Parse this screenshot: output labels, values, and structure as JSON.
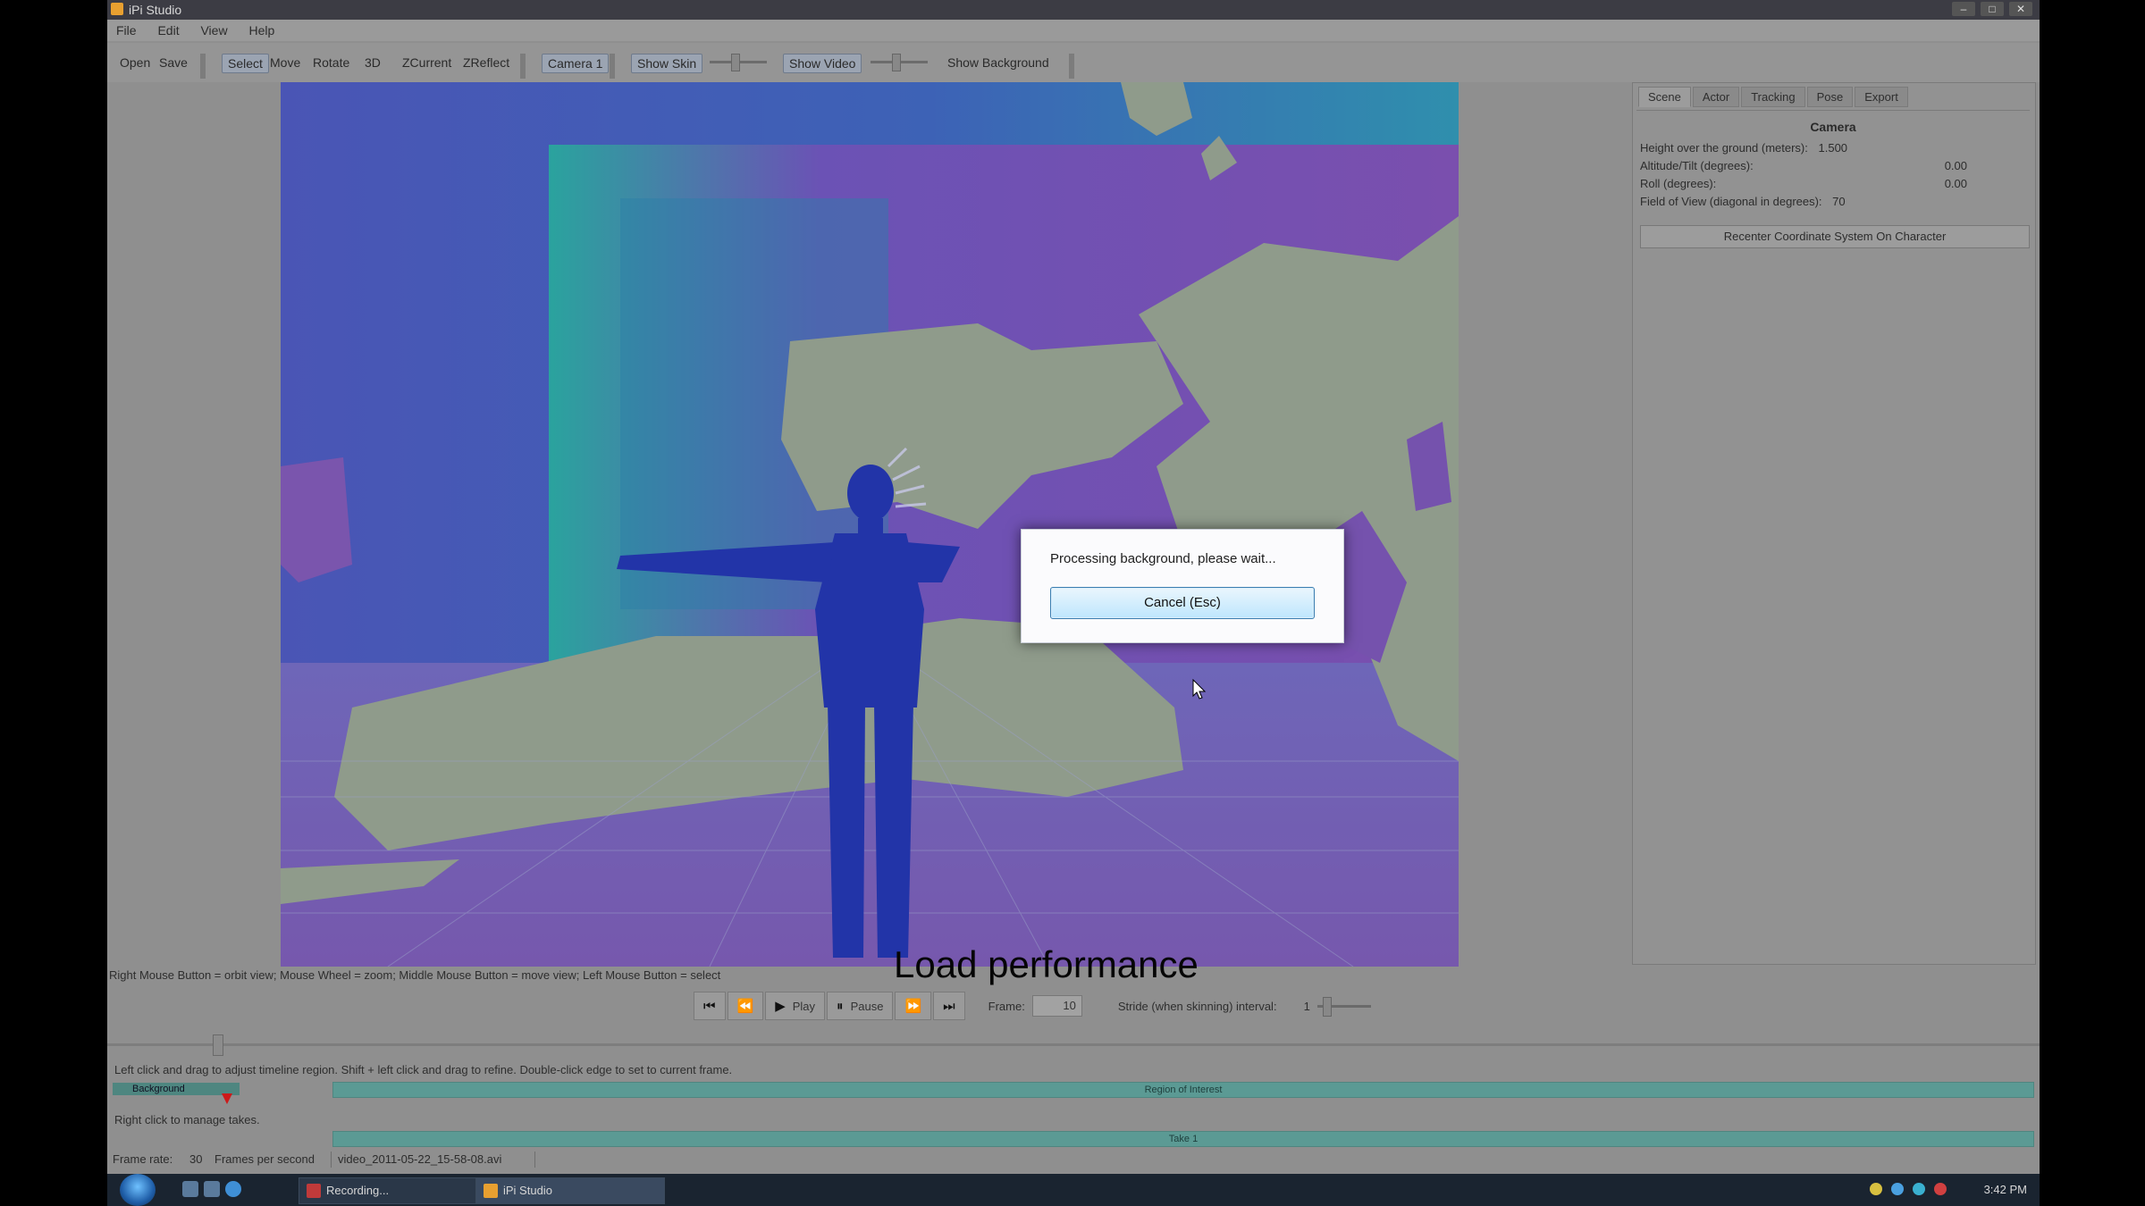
{
  "window": {
    "title": "iPi Studio",
    "controls": [
      "–",
      "□",
      "✕"
    ]
  },
  "menu": [
    "File",
    "Edit",
    "View",
    "Help"
  ],
  "toolbar": {
    "open": "Open",
    "save": "Save",
    "select": "Select",
    "move": "Move",
    "rotate": "Rotate",
    "view3d": "3D",
    "zcurrent": "ZCurrent",
    "zreflect": "ZReflect",
    "camera": "Camera 1",
    "show_skin": "Show Skin",
    "show_video": "Show Video",
    "show_background": "Show Background"
  },
  "right_panel": {
    "tabs": [
      "Scene",
      "Actor",
      "Tracking",
      "Pose",
      "Export"
    ],
    "active_tab": "Scene",
    "section_title": "Camera",
    "rows": [
      {
        "label": "Height over the ground (meters):",
        "value": "1.500"
      },
      {
        "label": "Altitude/Tilt (degrees):",
        "value": "0.00"
      },
      {
        "label": "Roll (degrees):",
        "value": "0.00"
      },
      {
        "label": "Field of View (diagonal in degrees):",
        "value": "70"
      }
    ],
    "recenter_button": "Recenter Coordinate System On Character"
  },
  "hints": {
    "mouse": "Right Mouse Button = orbit view; Mouse Wheel = zoom; Middle Mouse Button = move view; Left Mouse Button = select",
    "timeline": "Left click and drag to adjust timeline region. Shift + left click and drag to refine. Double-click edge to set to current frame.",
    "takes": "Right click to manage takes."
  },
  "caption": "Load performance",
  "playback": {
    "play": "Play",
    "pause": "Pause",
    "frame_label": "Frame:",
    "frame_value": "10",
    "interval_label": "Stride (when skinning) interval:",
    "interval_value": "1"
  },
  "timeline": {
    "background_tag": "Background",
    "region_label": "Region of Interest",
    "take_label": "Take 1"
  },
  "status": {
    "frame_rate": "Frame rate:",
    "fps_value": "30",
    "fps_label": "Frames per second",
    "file": "video_2011-05-22_15-58-08.avi"
  },
  "taskbar": {
    "tasks": [
      "Recording...",
      "iPi Studio"
    ],
    "clock": "3:42 PM"
  },
  "dialog": {
    "message": "Processing background, please wait...",
    "cancel_button": "Cancel (Esc)"
  },
  "colors": {
    "depth_far": "#3b55b8",
    "depth_mid": "#6a52b3",
    "depth_near": "#2aa5a2",
    "unknown_gray": "#8f9a8c",
    "person": "#2233a8",
    "accent_button": "#bee6fd"
  }
}
